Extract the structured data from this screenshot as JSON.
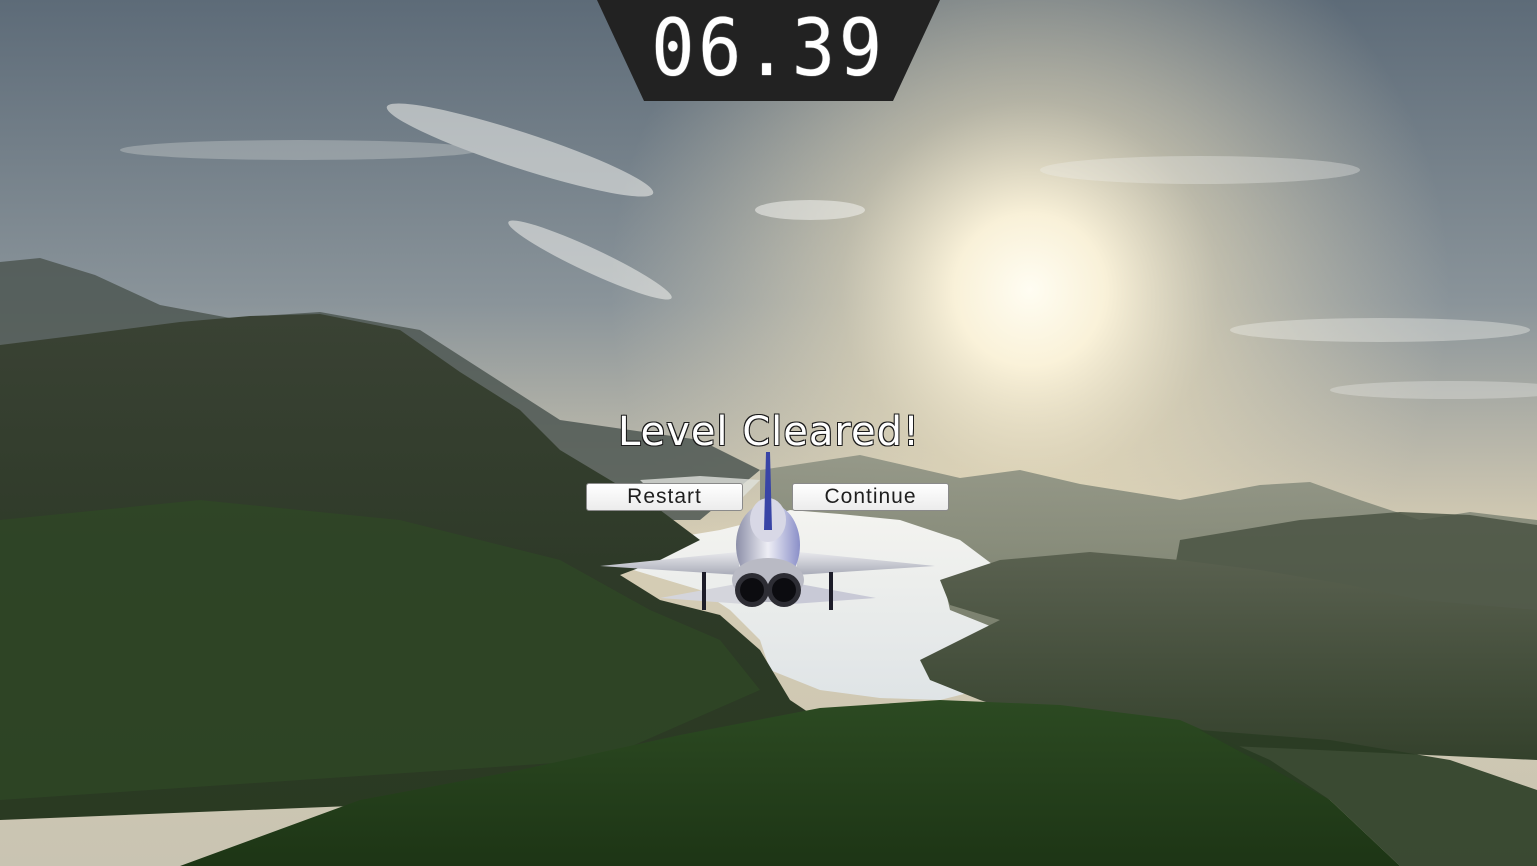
{
  "hud": {
    "timer": "06.39"
  },
  "result_dialog": {
    "title": "Level Cleared!",
    "restart_label": "Restart",
    "continue_label": "Continue"
  },
  "colors": {
    "timer_panel": "#222222",
    "timer_text": "#ffffff",
    "title_text": "#ffffff",
    "title_outline": "#1c1c1c",
    "button_face": "#f5f5f5",
    "button_text": "#1f1f1f",
    "sky_top": "#5d6b78",
    "sun_glow": "#fff8e0",
    "hills": "#2f3f2a",
    "lake": "#e9eef2"
  }
}
